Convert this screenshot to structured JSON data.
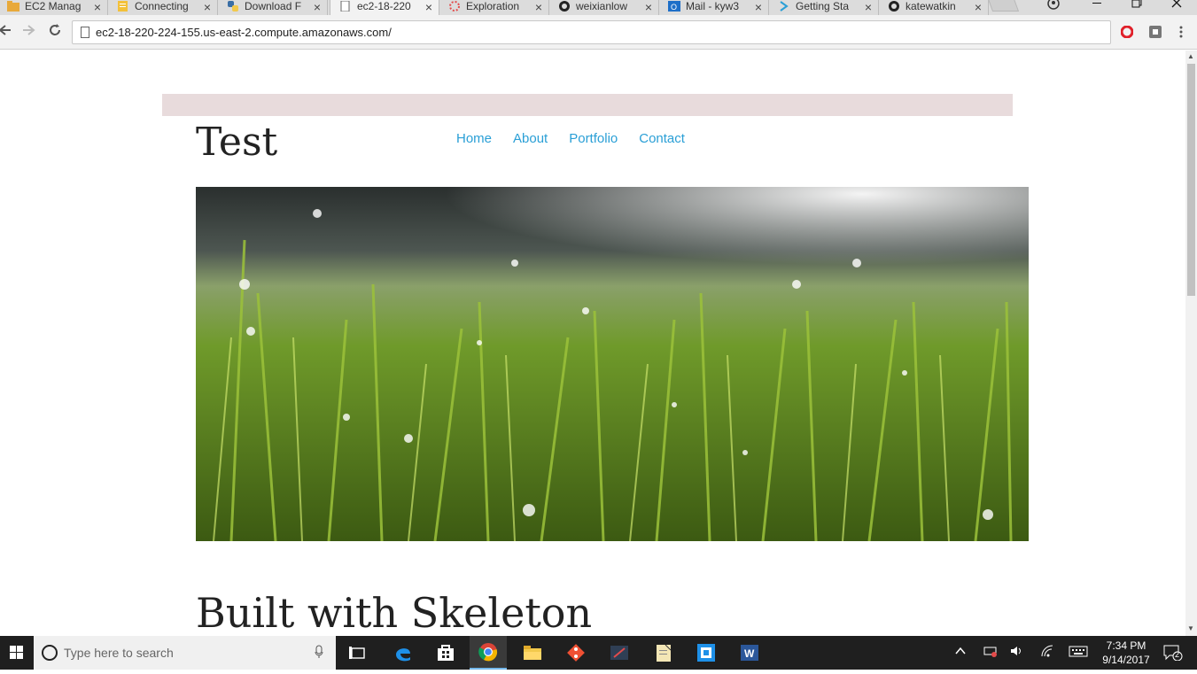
{
  "browser": {
    "tabs": [
      {
        "label": "EC2 Manag",
        "icon": "folder-icon",
        "active": false
      },
      {
        "label": "Connecting",
        "icon": "document-icon",
        "active": false
      },
      {
        "label": "Download F",
        "icon": "python-icon",
        "active": false
      },
      {
        "label": "ec2-18-220",
        "icon": "page-icon",
        "active": true
      },
      {
        "label": "Exploration",
        "icon": "loading-icon",
        "active": false
      },
      {
        "label": "weixianlow",
        "icon": "github-icon",
        "active": false
      },
      {
        "label": "Mail - kyw3",
        "icon": "outlook-icon",
        "active": false
      },
      {
        "label": "Getting Sta",
        "icon": "arrow-icon",
        "active": false
      },
      {
        "label": "katewatkin",
        "icon": "github-icon",
        "active": false
      }
    ],
    "close_glyph": "×",
    "url": "ec2-18-220-224-155.us-east-2.compute.amazonaws.com/"
  },
  "site": {
    "title": "Test",
    "nav": [
      "Home",
      "About",
      "Portfolio",
      "Contact"
    ],
    "heading": "Built with Skeleton",
    "link_color": "#2a9fd6",
    "banner_color": "#e8dbdc"
  },
  "taskbar": {
    "search_placeholder": "Type here to search",
    "time": "7:34 PM",
    "date": "9/14/2017",
    "notification_count": "2"
  }
}
